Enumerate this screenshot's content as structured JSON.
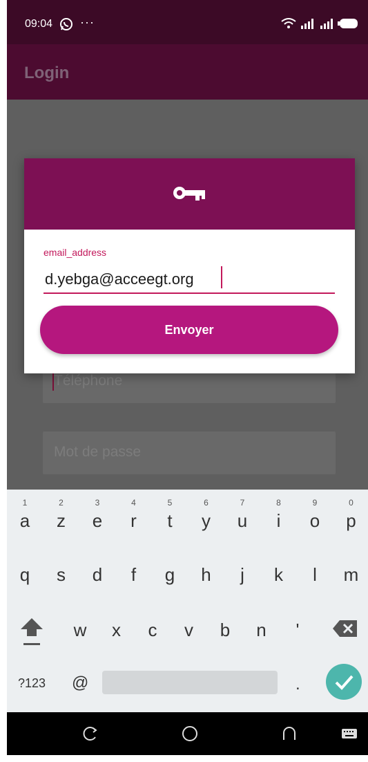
{
  "status_bar": {
    "time": "09:04",
    "dots": "···"
  },
  "app_bar": {
    "title": "Login"
  },
  "background_form": {
    "phone_placeholder": "Téléphone",
    "password_placeholder": "Mot de passe"
  },
  "dialog": {
    "field_label": "email_address",
    "email_value": "d.yebga@acceegt.org",
    "send_label": "Envoyer"
  },
  "keyboard": {
    "row1": [
      {
        "ch": "a",
        "sup": "1"
      },
      {
        "ch": "z",
        "sup": "2"
      },
      {
        "ch": "e",
        "sup": "3"
      },
      {
        "ch": "r",
        "sup": "4"
      },
      {
        "ch": "t",
        "sup": "5"
      },
      {
        "ch": "y",
        "sup": "6"
      },
      {
        "ch": "u",
        "sup": "7"
      },
      {
        "ch": "i",
        "sup": "8"
      },
      {
        "ch": "o",
        "sup": "9"
      },
      {
        "ch": "p",
        "sup": "0"
      }
    ],
    "row2": [
      "q",
      "s",
      "d",
      "f",
      "g",
      "h",
      "j",
      "k",
      "l",
      "m"
    ],
    "row3": [
      "w",
      "x",
      "c",
      "v",
      "b",
      "n",
      "'"
    ],
    "symbols_label": "?123",
    "at_label": "@",
    "period_label": "."
  },
  "colors": {
    "dialog_header": "#7d1054",
    "accent": "#c2185b",
    "button": "#b5177e",
    "done_key": "#4db6ac"
  },
  "icons": [
    "whatsapp-icon",
    "wifi-icon",
    "signal-icon",
    "battery-icon",
    "key-icon",
    "shift-icon",
    "backspace-icon",
    "check-icon",
    "recent-apps-icon",
    "home-icon",
    "back-icon",
    "keyboard-icon"
  ]
}
